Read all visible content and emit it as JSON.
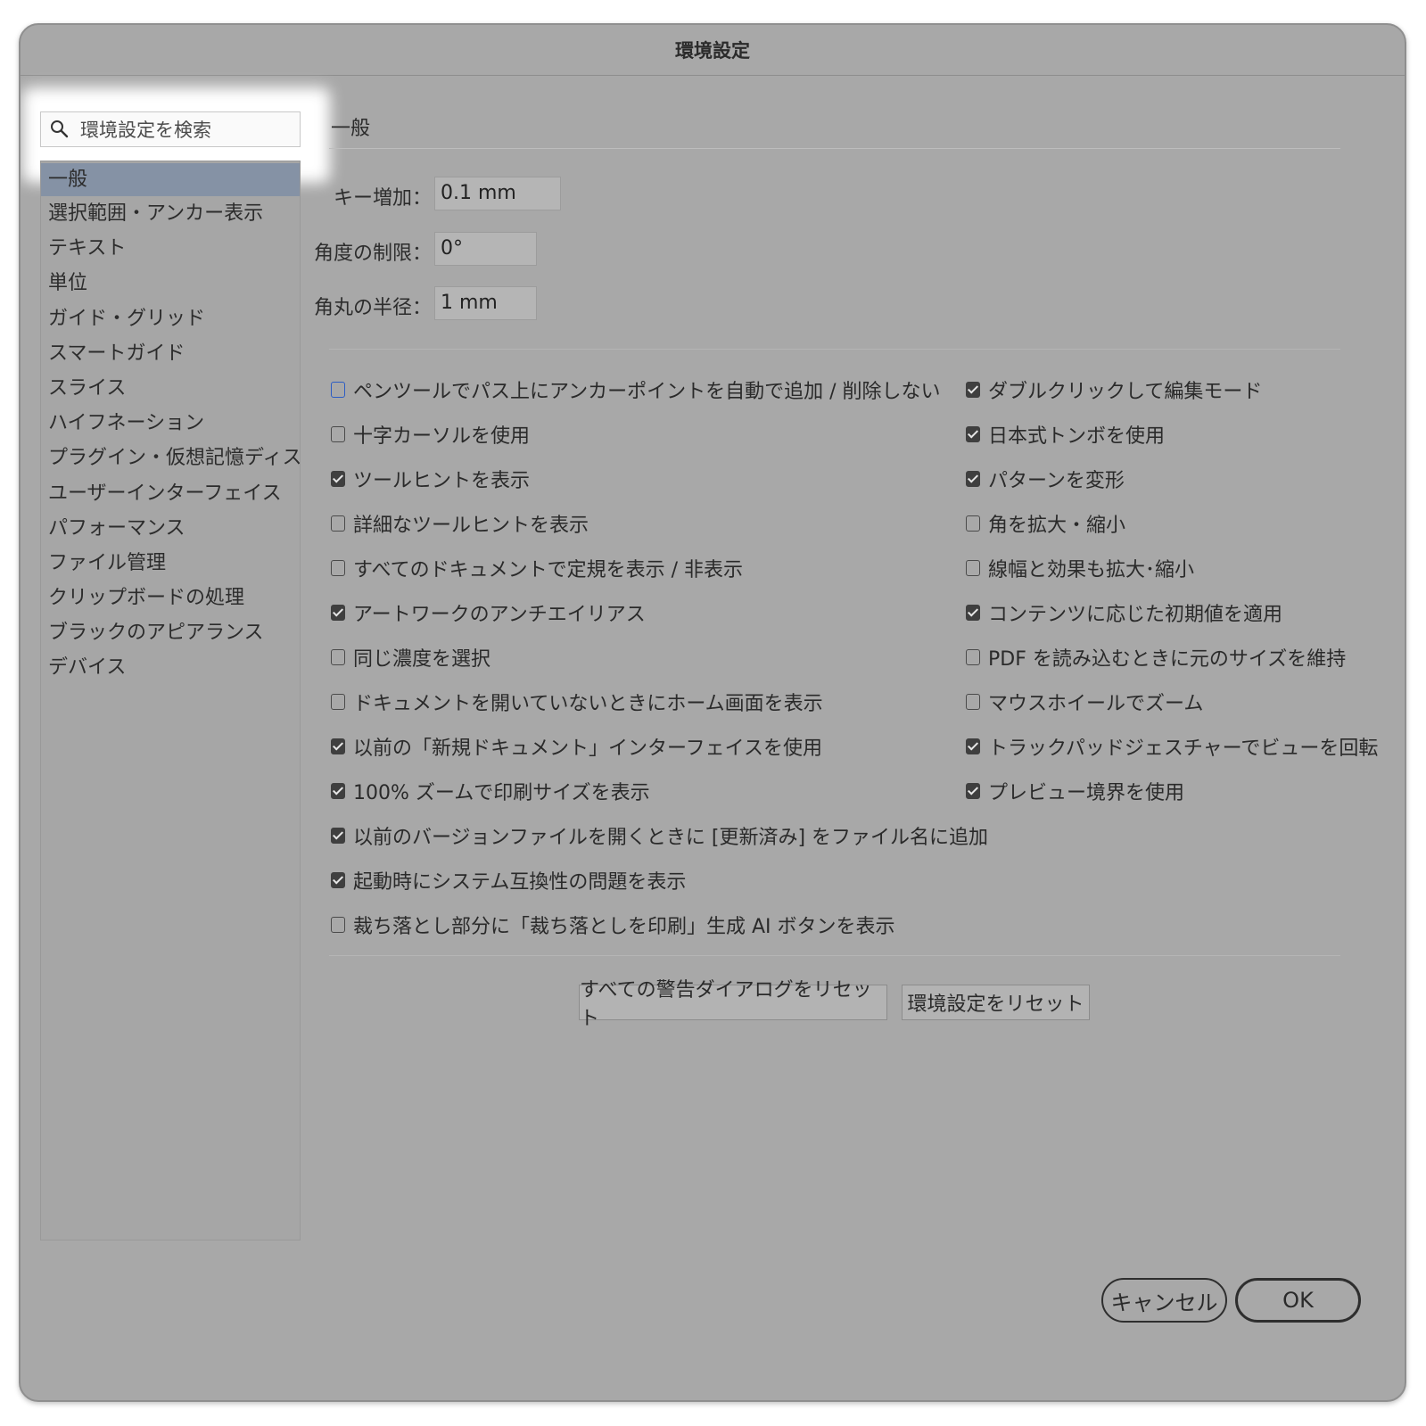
{
  "window": {
    "title": "環境設定"
  },
  "search": {
    "placeholder": "環境設定を検索"
  },
  "sidebar": {
    "items": [
      {
        "label": "一般",
        "selected": true
      },
      {
        "label": "選択範囲・アンカー表示"
      },
      {
        "label": "テキスト"
      },
      {
        "label": "単位"
      },
      {
        "label": "ガイド・グリッド"
      },
      {
        "label": "スマートガイド"
      },
      {
        "label": "スライス"
      },
      {
        "label": "ハイフネーション"
      },
      {
        "label": "プラグイン・仮想記憶ディスク"
      },
      {
        "label": "ユーザーインターフェイス"
      },
      {
        "label": "パフォーマンス"
      },
      {
        "label": "ファイル管理"
      },
      {
        "label": "クリップボードの処理"
      },
      {
        "label": "ブラックのアピアランス"
      },
      {
        "label": "デバイス"
      }
    ]
  },
  "main": {
    "section_title": "一般",
    "fields": [
      {
        "label": "キー増加：",
        "value": "0.1 mm"
      },
      {
        "label": "角度の制限：",
        "value": "0°"
      },
      {
        "label": "角丸の半径：",
        "value": "1 mm"
      }
    ],
    "left_options": [
      {
        "label": "ペンツールでパス上にアンカーポイントを自動で追加 / 削除しない",
        "checked": false,
        "focused": true
      },
      {
        "label": "十字カーソルを使用",
        "checked": false
      },
      {
        "label": "ツールヒントを表示",
        "checked": true
      },
      {
        "label": "詳細なツールヒントを表示",
        "checked": false
      },
      {
        "label": "すべてのドキュメントで定規を表示 / 非表示",
        "checked": false
      },
      {
        "label": "アートワークのアンチエイリアス",
        "checked": true
      },
      {
        "label": "同じ濃度を選択",
        "checked": false
      },
      {
        "label": "ドキュメントを開いていないときにホーム画面を表示",
        "checked": false
      },
      {
        "label": "以前の「新規ドキュメント」インターフェイスを使用",
        "checked": true
      },
      {
        "label": "100% ズームで印刷サイズを表示",
        "checked": true
      },
      {
        "label": "以前のバージョンファイルを開くときに [更新済み] をファイル名に追加",
        "checked": true
      },
      {
        "label": "起動時にシステム互換性の問題を表示",
        "checked": true
      },
      {
        "label": "裁ち落とし部分に「裁ち落としを印刷」生成 AI ボタンを表示",
        "checked": false
      }
    ],
    "right_options": [
      {
        "label": "ダブルクリックして編集モード",
        "checked": true
      },
      {
        "label": "日本式トンボを使用",
        "checked": true
      },
      {
        "label": "パターンを変形",
        "checked": true
      },
      {
        "label": "角を拡大・縮小",
        "checked": false
      },
      {
        "label": "線幅と効果も拡大･縮小",
        "checked": false
      },
      {
        "label": "コンテンツに応じた初期値を適用",
        "checked": true
      },
      {
        "label": "PDF を読み込むときに元のサイズを維持",
        "checked": false
      },
      {
        "label": "マウスホイールでズーム",
        "checked": false
      },
      {
        "label": "トラックパッドジェスチャーでビューを回転",
        "checked": true
      },
      {
        "label": "プレビュー境界を使用",
        "checked": true
      }
    ],
    "reset_warnings_label": "すべての警告ダイアログをリセット",
    "reset_prefs_label": "環境設定をリセット"
  },
  "footer": {
    "cancel_label": "キャンセル",
    "ok_label": "OK"
  }
}
